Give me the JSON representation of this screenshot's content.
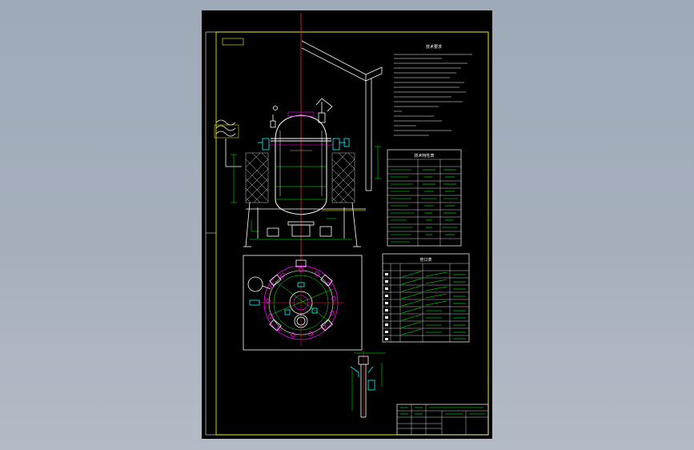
{
  "drawing": {
    "drawing_number_tab": "",
    "tech_requirements_title": "技术要求",
    "tech_notes": [],
    "tech_characteristics_table": {
      "title": "技术特性表",
      "rows": []
    },
    "nozzle_table": {
      "title": "管口表",
      "rows": []
    },
    "title_block": {
      "drawing_title": "",
      "company": ""
    }
  },
  "colors": {
    "background": "#000000",
    "frame": "#ffff00",
    "vessel": "#ffffff",
    "dimension": "#00ff00",
    "centerline": "#ff2020",
    "nozzle": "#00ffff",
    "insulation": "#c8c8c8",
    "accent": "#ff00ff"
  }
}
